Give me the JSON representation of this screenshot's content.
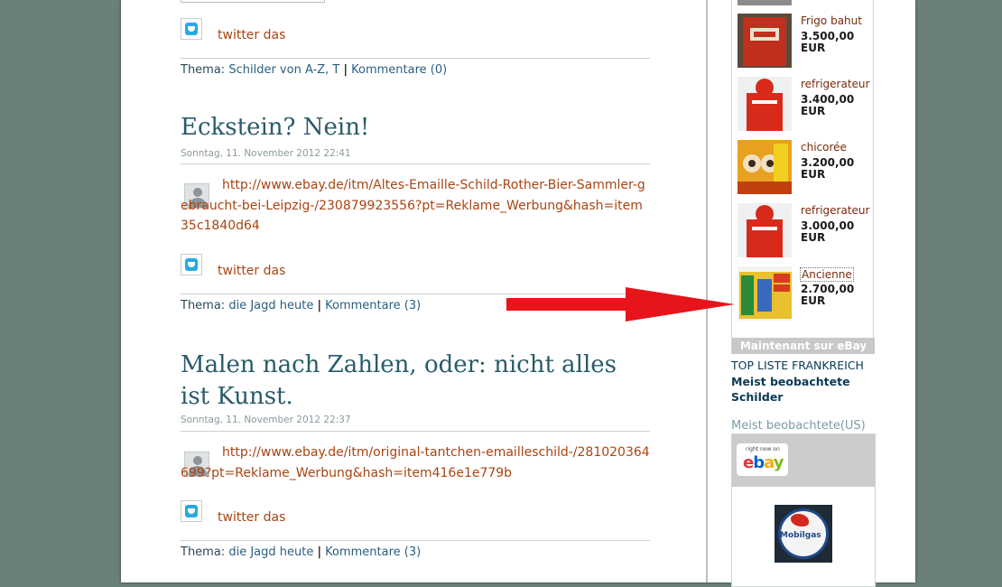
{
  "posts": [
    {
      "twitter": "twitter das",
      "meta": {
        "prefix": "Thema:",
        "topic": "Schilder von A-Z, T",
        "sep": "|",
        "comments": "Kommentare (0)"
      }
    },
    {
      "title": "Eckstein? Nein!",
      "date": "Sonntag, 11. November 2012 22:41",
      "link": "http://www.ebay.de/itm/Altes-Emaille-Schild-Rother-Bier-Sammler-gebraucht-bei-Leipzig-/230879923556?pt=Reklame_Werbung&hash=item35c1840d64",
      "twitter": "twitter das",
      "meta": {
        "prefix": "Thema:",
        "topic": "die Jagd heute",
        "sep": "|",
        "comments": "Kommentare (3)"
      }
    },
    {
      "title": "Malen nach Zahlen, oder: nicht alles ist Kunst.",
      "date": "Sonntag, 11. November 2012 22:37",
      "link": "http://www.ebay.de/itm/original-tantchen-emailleschild-/281020364699?pt=Reklame_Werbung&hash=item416e1e779b",
      "twitter": "twitter das",
      "meta": {
        "prefix": "Thema:",
        "topic": "die Jagd heute",
        "sep": "|",
        "comments": "Kommentare (3)"
      }
    }
  ],
  "sidebar": {
    "ebay_items": [
      {
        "title": "Frigo bahut",
        "price": "3.500,00 EUR",
        "icon": "coca-cola-fridge-thumbnail"
      },
      {
        "title": "refrigerateur",
        "price": "3.400,00 EUR",
        "icon": "red-fridge-thumbnail"
      },
      {
        "title": "chicorée",
        "price": "3.200,00 EUR",
        "icon": "chicory-sign-thumbnail"
      },
      {
        "title": "refrigerateur",
        "price": "3.000,00 EUR",
        "icon": "red-fridge-thumbnail"
      },
      {
        "title": "Ancienne",
        "price": "2.700,00 EUR",
        "icon": "shell-benzin-sign-thumbnail"
      }
    ],
    "maintenant": "Maintenant sur eBay",
    "top_liste": "TOP LISTE FRANKREICH",
    "meist": "Meist beobachtete Schilder",
    "meist_us": "Meist beobachtete(US)",
    "ebay_right_now": "right now on",
    "mobilgas_label": "Mobilgas"
  },
  "colors": {
    "background": "#6b7f7b",
    "link": "#a94411",
    "title": "#2a5b6b",
    "arrow": "#e8141b"
  }
}
